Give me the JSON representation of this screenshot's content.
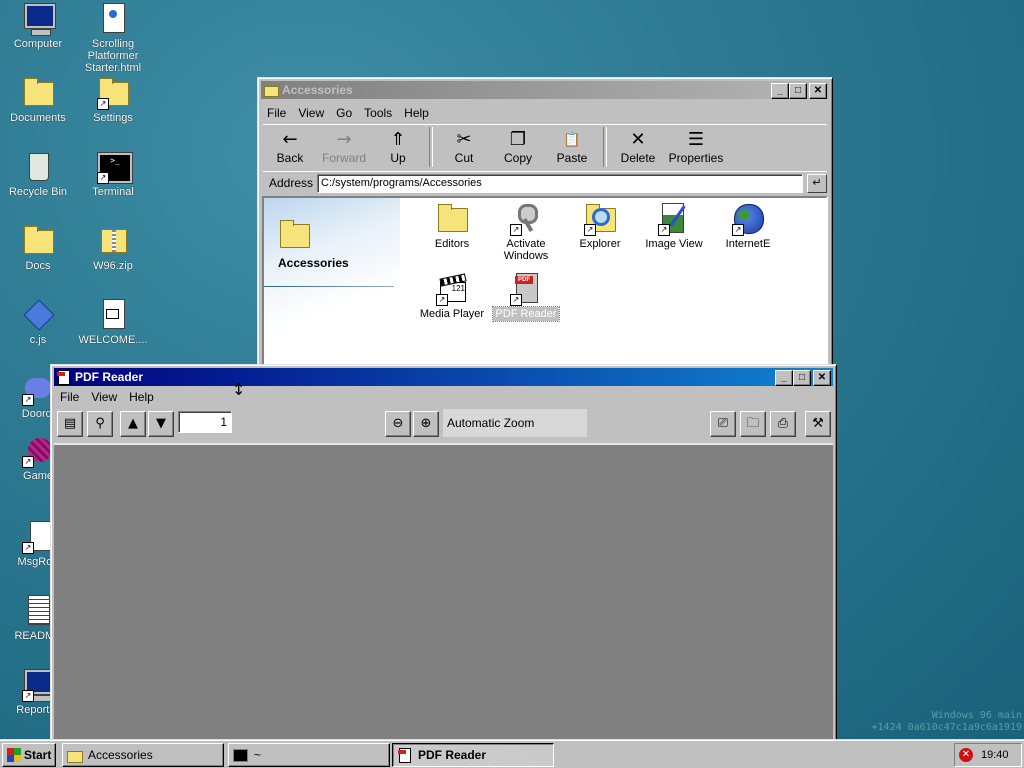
{
  "desktop": {
    "icons": [
      {
        "label": "Computer"
      },
      {
        "label": "Scrolling Platformer Starter.html"
      },
      {
        "label": "Documents"
      },
      {
        "label": "Settings"
      },
      {
        "label": "Recycle Bin"
      },
      {
        "label": "Terminal"
      },
      {
        "label": "Docs"
      },
      {
        "label": "W96.zip"
      },
      {
        "label": "c.js"
      },
      {
        "label": "WELCOME...."
      },
      {
        "label": "Doordi"
      },
      {
        "label": "Game"
      },
      {
        "label": "MsgRoo"
      },
      {
        "label": "README"
      },
      {
        "label": "Report B"
      }
    ],
    "watermark_line1": "Windows 96 main",
    "watermark_line2": "+1424 0a610c47c1a9c6a1919"
  },
  "explorer": {
    "title": "Accessories",
    "menu": [
      "File",
      "View",
      "Go",
      "Tools",
      "Help"
    ],
    "toolbar": [
      {
        "label": "Back",
        "icon": "←",
        "disabled": false
      },
      {
        "label": "Forward",
        "icon": "→",
        "disabled": true
      },
      {
        "label": "Up",
        "icon": "⇑",
        "disabled": false
      },
      {
        "label": "Cut",
        "icon": "✂",
        "disabled": false
      },
      {
        "label": "Copy",
        "icon": "❐",
        "disabled": false
      },
      {
        "label": "Paste",
        "icon": "📋",
        "disabled": false
      },
      {
        "label": "Delete",
        "icon": "✕",
        "disabled": false
      },
      {
        "label": "Properties",
        "icon": "☰",
        "disabled": false
      }
    ],
    "address_label": "Address",
    "address_value": "C:/system/programs/Accessories",
    "sidebar_title": "Accessories",
    "items": [
      {
        "label": "Editors",
        "icon": "folder-icon"
      },
      {
        "label": "Activate Windows",
        "icon": "keys-icon"
      },
      {
        "label": "Explorer",
        "icon": "magnifier-icon"
      },
      {
        "label": "Image View",
        "icon": "image-icon"
      },
      {
        "label": "InternetE",
        "icon": "globe-icon"
      },
      {
        "label": "Media Player",
        "icon": "clapper-icon"
      },
      {
        "label": "PDF Reader",
        "icon": "pdf-icon",
        "selected": true
      }
    ]
  },
  "pdf_reader": {
    "title": "PDF Reader",
    "menu": [
      "File",
      "View",
      "Help"
    ],
    "page_number": "1",
    "zoom": "Automatic Zoom"
  },
  "taskbar": {
    "start_label": "Start",
    "tasks": [
      {
        "label": "Accessories"
      },
      {
        "label": "~"
      },
      {
        "label": "PDF Reader"
      }
    ],
    "clock": "19:40"
  }
}
